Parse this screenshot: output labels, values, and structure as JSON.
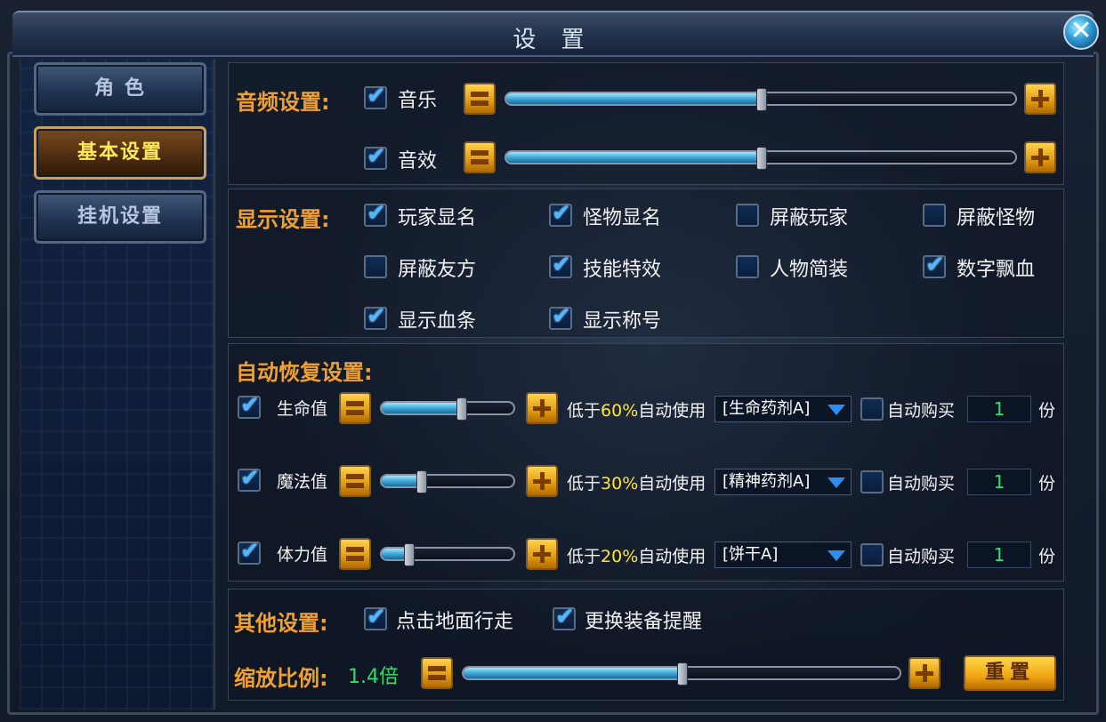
{
  "window": {
    "title": "设 置",
    "close_icon": "close-icon"
  },
  "sidebar": {
    "items": [
      {
        "label": "角 色"
      },
      {
        "label": "基本设置"
      },
      {
        "label": "挂机设置"
      }
    ],
    "active_index": 1
  },
  "audio": {
    "title": "音频设置:",
    "music": {
      "label": "音乐",
      "checked": true,
      "level": 0.5
    },
    "sfx": {
      "label": "音效",
      "checked": true,
      "level": 0.5
    }
  },
  "display": {
    "title": "显示设置:",
    "options": [
      {
        "label": "玩家显名",
        "checked": true
      },
      {
        "label": "怪物显名",
        "checked": true
      },
      {
        "label": "屏蔽玩家",
        "checked": false
      },
      {
        "label": "屏蔽怪物",
        "checked": false
      },
      {
        "label": "屏蔽友方",
        "checked": false
      },
      {
        "label": "技能特效",
        "checked": true
      },
      {
        "label": "人物简装",
        "checked": false
      },
      {
        "label": "数字飘血",
        "checked": true
      },
      {
        "label": "显示血条",
        "checked": true
      },
      {
        "label": "显示称号",
        "checked": true
      }
    ]
  },
  "recovery": {
    "title": "自动恢复设置:",
    "rows": [
      {
        "label": "生命值",
        "checked": true,
        "level": 0.6,
        "below": "低于",
        "pct": "60%",
        "use": "自动使用",
        "item": "[生命药剂A]",
        "autobuy_label": "自动购买",
        "autobuy_checked": false,
        "qty": "1",
        "unit": "份"
      },
      {
        "label": "魔法值",
        "checked": true,
        "level": 0.3,
        "below": "低于",
        "pct": "30%",
        "use": "自动使用",
        "item": "[精神药剂A]",
        "autobuy_label": "自动购买",
        "autobuy_checked": false,
        "qty": "1",
        "unit": "份"
      },
      {
        "label": "体力值",
        "checked": true,
        "level": 0.2,
        "below": "低于",
        "pct": "20%",
        "use": "自动使用",
        "item": "  [饼干A]",
        "autobuy_label": "自动购买",
        "autobuy_checked": false,
        "qty": "1",
        "unit": "份"
      }
    ]
  },
  "other": {
    "title": "其他设置:",
    "options": [
      {
        "label": "点击地面行走",
        "checked": true
      },
      {
        "label": "更换装备提醒",
        "checked": true
      }
    ],
    "zoom_label": "缩放比例:",
    "zoom_value": "1.4倍",
    "zoom_level": 0.5,
    "reset_label": "重置"
  },
  "colors": {
    "accent": "#f0a030",
    "checkbox_tick": "#4fb6ff",
    "highlight": "#ffe633",
    "value_green": "#2ee06a"
  }
}
